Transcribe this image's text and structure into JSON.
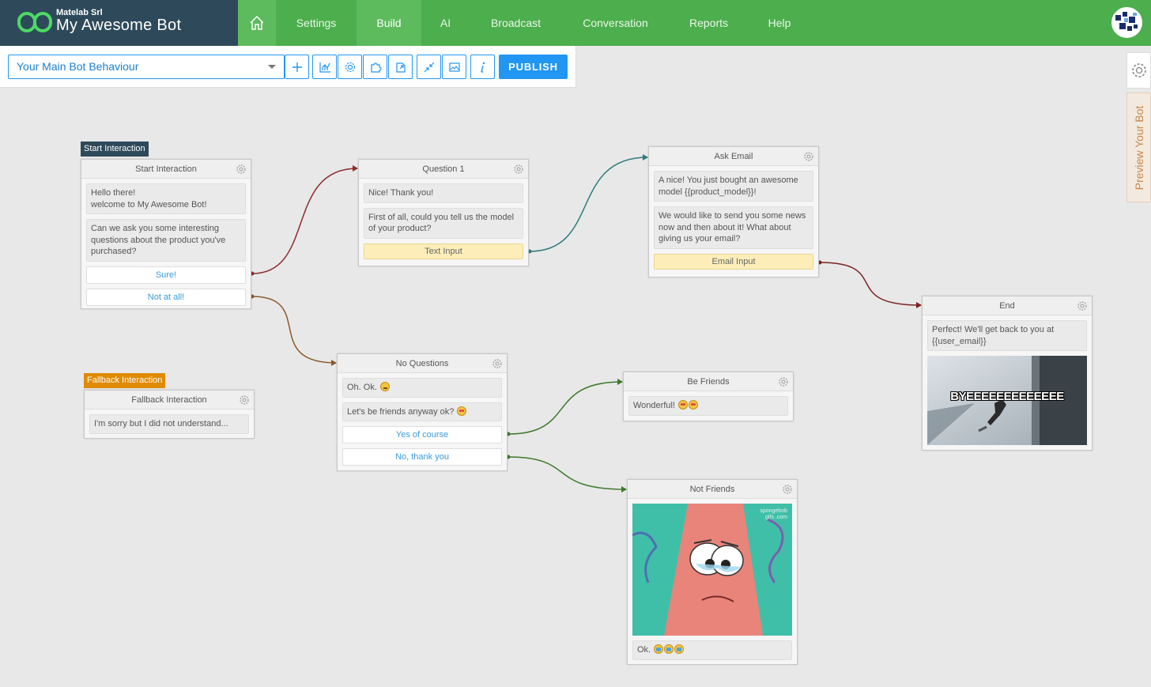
{
  "brand": {
    "org": "Matelab Srl",
    "name": "My Awesome Bot"
  },
  "nav": {
    "home_icon": "home-icon",
    "items": [
      {
        "label": "Settings",
        "active": false
      },
      {
        "label": "Build",
        "active": true
      },
      {
        "label": "AI",
        "active": false
      },
      {
        "label": "Broadcast",
        "active": false
      },
      {
        "label": "Conversation",
        "active": false
      },
      {
        "label": "Reports",
        "active": false
      },
      {
        "label": "Help",
        "active": false
      }
    ]
  },
  "toolbar": {
    "behaviour": "Your Main Bot Behaviour",
    "icons": [
      "plus-icon",
      "chart-icon",
      "gear-icon",
      "puzzle-icon",
      "export-icon",
      "collapse-icon",
      "image-icon",
      "info-icon"
    ],
    "publish": "PUBLISH"
  },
  "preview": {
    "label": "Preview Your Bot"
  },
  "colors": {
    "topbar": "#4cae4c",
    "brand": "#2e4a5a",
    "accent": "#2196f3",
    "start_tag": "#2e4a5a",
    "fallback_tag": "#e08a00"
  },
  "nodes": {
    "start": {
      "tag": "Start Interaction",
      "title": "Start Interaction",
      "msg1": "Hello there!\nwelcome to My Awesome Bot!",
      "msg2": "Can we ask you some interesting questions about the product you've purchased?",
      "opt1": "Sure!",
      "opt2": "Not at all!"
    },
    "fallback": {
      "tag": "Fallback Interaction",
      "title": "Fallback Interaction",
      "msg1": "I'm sorry but I did not understand..."
    },
    "question1": {
      "title": "Question 1",
      "msg1": "Nice! Thank you!",
      "msg2": "First of all, could you tell us the model of your product?",
      "input": "Text Input"
    },
    "ask_email": {
      "title": "Ask Email",
      "msg1": "A nice! You just bought an awesome model {{product_model}}!",
      "msg2": "We would like to send you some news now and then about it! What about giving us your email?",
      "input": "Email Input"
    },
    "end": {
      "title": "End",
      "msg1": "Perfect! We'll get back to you at {{user_email}}",
      "gif_text": "BYEEEEEEEEEEEEE"
    },
    "no_questions": {
      "title": "No Questions",
      "msg1": "Oh. Ok.",
      "msg2": "Let's be friends anyway ok?",
      "opt1": "Yes of course",
      "opt2": "No, thank you"
    },
    "be_friends": {
      "title": "Be Friends",
      "msg1": "Wonderful!"
    },
    "not_friends": {
      "title": "Not Friends",
      "msg1": "Ok.",
      "gif_watermark": "spongebob gifs .com"
    }
  }
}
